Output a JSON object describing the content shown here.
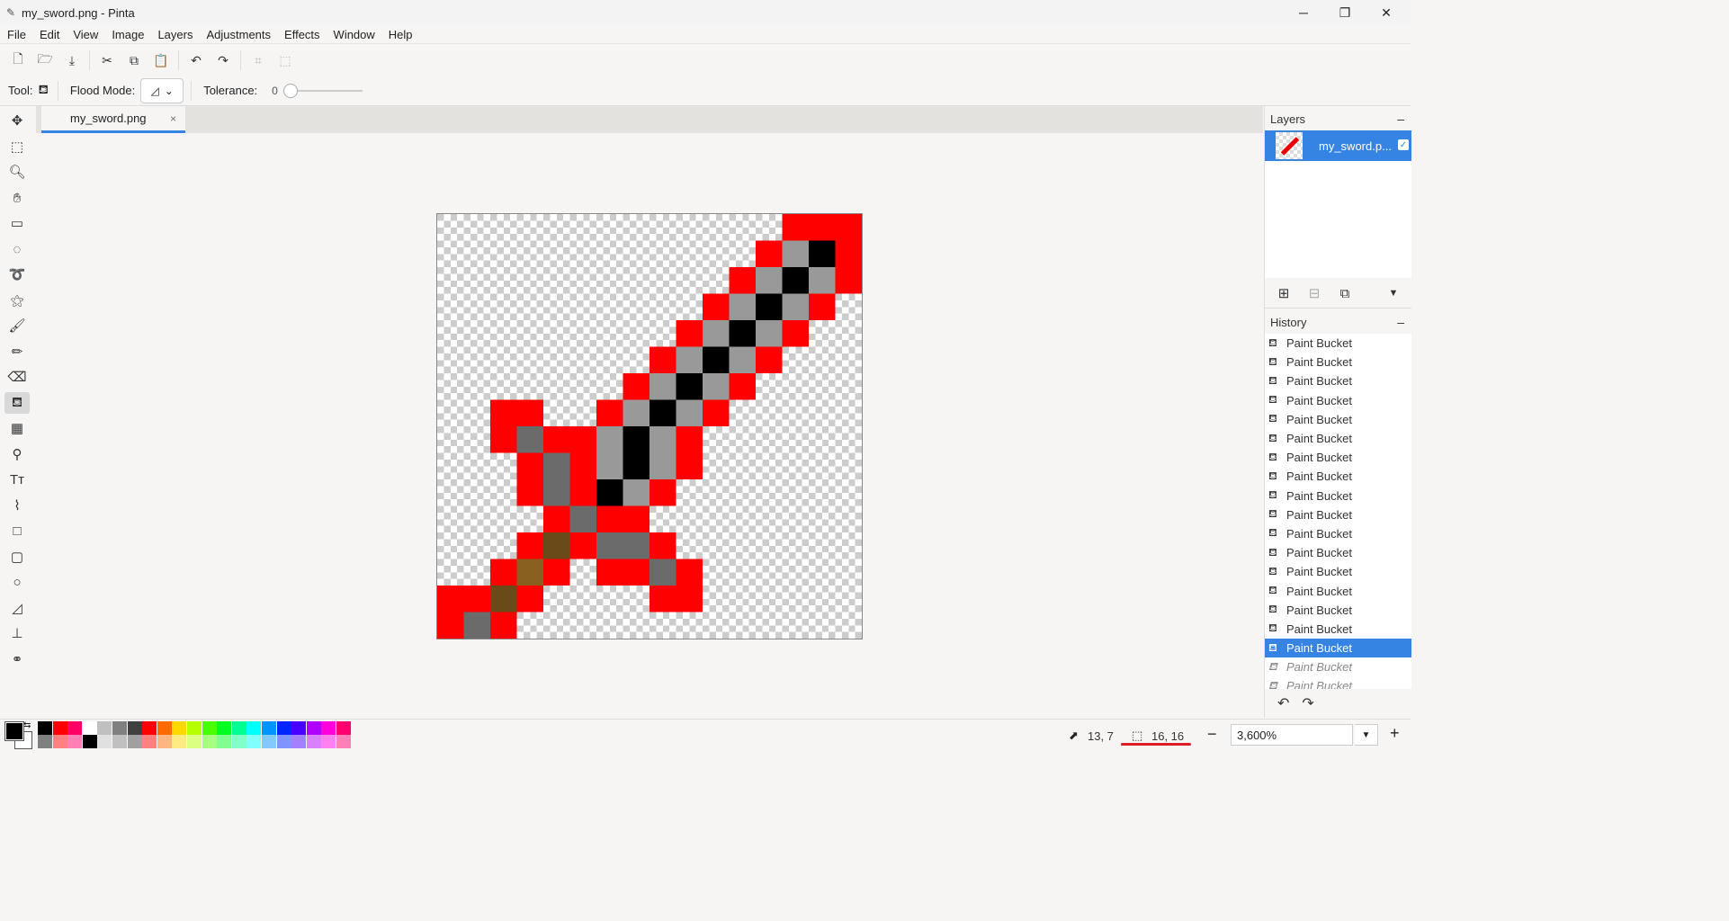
{
  "window": {
    "title": "my_sword.png - Pinta"
  },
  "menu": [
    "File",
    "Edit",
    "View",
    "Image",
    "Layers",
    "Adjustments",
    "Effects",
    "Window",
    "Help"
  ],
  "tool_options": {
    "tool_label": "Tool:",
    "flood_mode_label": "Flood Mode:",
    "tolerance_label": "Tolerance:",
    "tolerance_value": "0",
    "tolerance": 0
  },
  "document_tab": {
    "name": "my_sword.png",
    "close": "×"
  },
  "layers_panel": {
    "title": "Layers",
    "layer_name": "my_sword.p...",
    "collapse": "–",
    "visible": true
  },
  "history_panel": {
    "title": "History",
    "collapse": "–",
    "items": [
      {
        "label": "Paint Bucket",
        "state": "done"
      },
      {
        "label": "Paint Bucket",
        "state": "done"
      },
      {
        "label": "Paint Bucket",
        "state": "done"
      },
      {
        "label": "Paint Bucket",
        "state": "done"
      },
      {
        "label": "Paint Bucket",
        "state": "done"
      },
      {
        "label": "Paint Bucket",
        "state": "done"
      },
      {
        "label": "Paint Bucket",
        "state": "done"
      },
      {
        "label": "Paint Bucket",
        "state": "done"
      },
      {
        "label": "Paint Bucket",
        "state": "done"
      },
      {
        "label": "Paint Bucket",
        "state": "done"
      },
      {
        "label": "Paint Bucket",
        "state": "done"
      },
      {
        "label": "Paint Bucket",
        "state": "done"
      },
      {
        "label": "Paint Bucket",
        "state": "done"
      },
      {
        "label": "Paint Bucket",
        "state": "done"
      },
      {
        "label": "Paint Bucket",
        "state": "done"
      },
      {
        "label": "Paint Bucket",
        "state": "done"
      },
      {
        "label": "Paint Bucket",
        "state": "selected"
      },
      {
        "label": "Paint Bucket",
        "state": "future"
      },
      {
        "label": "Paint Bucket",
        "state": "future"
      }
    ]
  },
  "status": {
    "cursor_position": "13, 7",
    "selection_size": "16, 16",
    "zoom": "3,600%",
    "zoom_out": "−",
    "zoom_in": "+"
  },
  "colors": {
    "accent": "#3584e4",
    "primary": "#000000",
    "secondary": "#ffffff",
    "underline": "#e01b24"
  },
  "image_pixels": {
    "width": 16,
    "height": 16,
    "palette": {
      ".": null,
      "R": "#ff0000",
      "g": "#999999",
      "k": "#000000",
      "d": "#6b6b6b",
      "b": "#6b4a1a",
      "o": "#8a6020"
    },
    "rows": [
      ".............RRR",
      "............RgkR",
      "...........RgkgR",
      "..........RgkgR.",
      ".........RgkgR..",
      "........RgkgR...",
      ".......RgkgR....",
      "..RR..RgkgR.....",
      "..RdRRgkgR......",
      "...RdRgkgR......",
      "...RdRkgR.......",
      "....RdRR........",
      "...RbRddR.......",
      "..RoR.RRdR......",
      "RRbR....RR......",
      "RdR.............",
      "RRR............."
    ]
  },
  "palette_colors": [
    "#000000",
    "#ff0000",
    "#ff0066",
    "#ffffff",
    "#c0c0c0",
    "#808080",
    "#404040",
    "#ff0000",
    "#ff6a00",
    "#ffd800",
    "#b6ff00",
    "#4cff00",
    "#00ff21",
    "#00ff90",
    "#00ffff",
    "#0094ff",
    "#0026ff",
    "#4800ff",
    "#b200ff",
    "#ff00dc",
    "#ff006e"
  ]
}
